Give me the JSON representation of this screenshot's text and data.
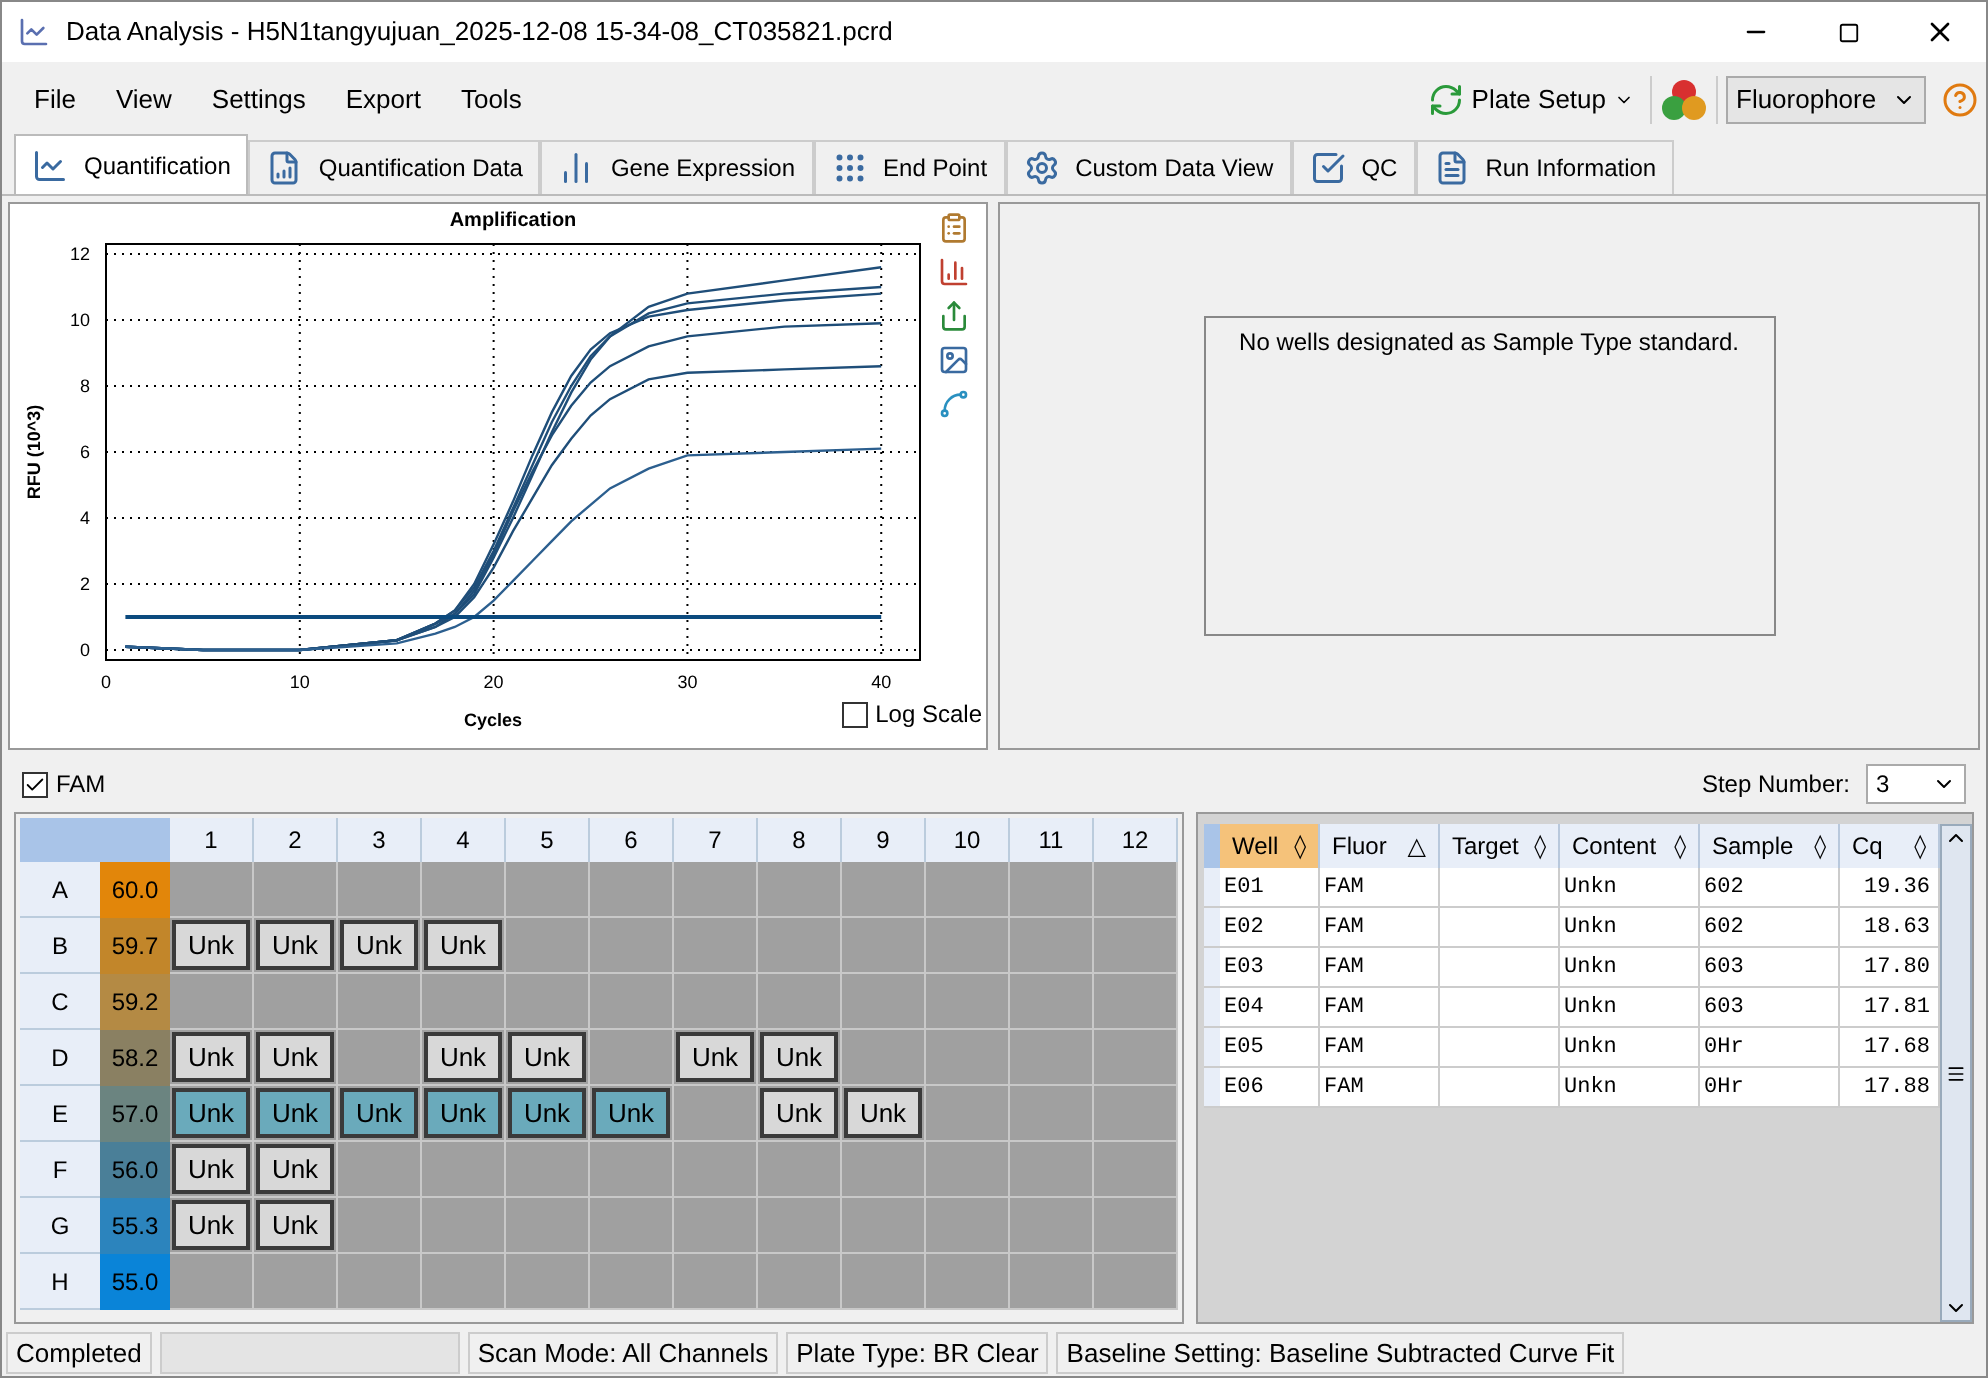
{
  "window": {
    "title": "Data Analysis - H5N1tangyujuan_2025-12-08 15-34-08_CT035821.pcrd"
  },
  "menu": [
    "File",
    "View",
    "Settings",
    "Export",
    "Tools"
  ],
  "toolbar": {
    "plate_setup": "Plate Setup",
    "fluorophore": "Fluorophore"
  },
  "tabs": [
    {
      "label": "Quantification",
      "selected": true
    },
    {
      "label": "Quantification Data",
      "selected": false
    },
    {
      "label": "Gene Expression",
      "selected": false
    },
    {
      "label": "End Point",
      "selected": false
    },
    {
      "label": "Custom Data View",
      "selected": false
    },
    {
      "label": "QC",
      "selected": false
    },
    {
      "label": "Run Information",
      "selected": false
    }
  ],
  "chart": {
    "log_scale": {
      "label": "Log Scale",
      "checked": false
    },
    "chart_data": {
      "type": "line",
      "title": "Amplification",
      "xlabel": "Cycles",
      "ylabel": "RFU (10^3)",
      "x": [
        1,
        5,
        10,
        15,
        17,
        18,
        19,
        20,
        21,
        22,
        23,
        24,
        25,
        26,
        28,
        30,
        35,
        40
      ],
      "series": [
        {
          "color": "#1f4e79",
          "values": [
            0.1,
            0,
            0,
            0.3,
            0.7,
            1.1,
            1.7,
            2.8,
            4.0,
            5.3,
            6.6,
            7.8,
            8.8,
            9.5,
            10.4,
            10.8,
            11.2,
            11.6
          ]
        },
        {
          "color": "#1f4e79",
          "values": [
            0.1,
            0,
            0,
            0.3,
            0.8,
            1.2,
            1.9,
            3.0,
            4.3,
            5.6,
            6.9,
            8.0,
            8.9,
            9.5,
            10.2,
            10.5,
            10.8,
            11.0
          ]
        },
        {
          "color": "#1f4e79",
          "values": [
            0.1,
            0,
            0,
            0.3,
            0.8,
            1.2,
            2.0,
            3.2,
            4.5,
            5.9,
            7.2,
            8.3,
            9.1,
            9.6,
            10.1,
            10.3,
            10.6,
            10.8
          ]
        },
        {
          "color": "#1f4e79",
          "values": [
            0.1,
            0,
            0,
            0.3,
            0.8,
            1.1,
            1.8,
            2.9,
            4.2,
            5.4,
            6.5,
            7.4,
            8.1,
            8.6,
            9.2,
            9.5,
            9.8,
            9.9
          ]
        },
        {
          "color": "#1f4e79",
          "values": [
            0.1,
            0,
            0,
            0.3,
            0.7,
            1.0,
            1.6,
            2.5,
            3.6,
            4.6,
            5.6,
            6.4,
            7.1,
            7.6,
            8.2,
            8.4,
            8.5,
            8.6
          ]
        },
        {
          "color": "#2c5f8f",
          "values": [
            0.1,
            0,
            0,
            0.2,
            0.5,
            0.7,
            1.0,
            1.5,
            2.1,
            2.7,
            3.3,
            3.9,
            4.4,
            4.9,
            5.5,
            5.9,
            6.0,
            6.1
          ]
        },
        {
          "color": "#0b4a7e",
          "values": [
            1,
            1,
            1,
            1,
            1,
            1,
            1,
            1,
            1,
            1,
            1,
            1,
            1,
            1,
            1,
            1,
            1,
            1
          ]
        }
      ],
      "grid": true,
      "xlim": [
        0,
        42
      ],
      "ylim": [
        -0.3,
        12.3
      ],
      "xticks": [
        0,
        10,
        20,
        30,
        40
      ],
      "yticks": [
        0,
        2,
        4,
        6,
        8,
        10,
        12
      ]
    }
  },
  "standard_curve": {
    "message": "No wells designated as Sample Type standard."
  },
  "fluor_filter": {
    "label": "FAM",
    "checked": true
  },
  "step": {
    "label": "Step Number:",
    "value": "3"
  },
  "plate": {
    "columns": [
      "1",
      "2",
      "3",
      "4",
      "5",
      "6",
      "7",
      "8",
      "9",
      "10",
      "11",
      "12"
    ],
    "rows": [
      {
        "label": "A",
        "temperature": "60.0",
        "color": "#e2860a",
        "wells": [
          {
            "kind": "empty"
          },
          {
            "kind": "empty"
          },
          {
            "kind": "empty"
          },
          {
            "kind": "empty"
          },
          {
            "kind": "empty"
          },
          {
            "kind": "empty"
          },
          {
            "kind": "empty"
          },
          {
            "kind": "empty"
          },
          {
            "kind": "empty"
          },
          {
            "kind": "empty"
          },
          {
            "kind": "empty"
          },
          {
            "kind": "empty"
          }
        ]
      },
      {
        "label": "B",
        "temperature": "59.7",
        "color": "#c2862a",
        "wells": [
          {
            "kind": "sample",
            "label": "Unk",
            "selected": false
          },
          {
            "kind": "sample",
            "label": "Unk",
            "selected": false
          },
          {
            "kind": "sample",
            "label": "Unk",
            "selected": false
          },
          {
            "kind": "sample",
            "label": "Unk",
            "selected": false
          },
          {
            "kind": "empty"
          },
          {
            "kind": "empty"
          },
          {
            "kind": "empty"
          },
          {
            "kind": "empty"
          },
          {
            "kind": "empty"
          },
          {
            "kind": "empty"
          },
          {
            "kind": "empty"
          },
          {
            "kind": "empty"
          }
        ]
      },
      {
        "label": "C",
        "temperature": "59.2",
        "color": "#b48a44",
        "wells": [
          {
            "kind": "empty"
          },
          {
            "kind": "empty"
          },
          {
            "kind": "empty"
          },
          {
            "kind": "empty"
          },
          {
            "kind": "empty"
          },
          {
            "kind": "empty"
          },
          {
            "kind": "empty"
          },
          {
            "kind": "empty"
          },
          {
            "kind": "empty"
          },
          {
            "kind": "empty"
          },
          {
            "kind": "empty"
          },
          {
            "kind": "empty"
          }
        ]
      },
      {
        "label": "D",
        "temperature": "58.2",
        "color": "#8a8062",
        "wells": [
          {
            "kind": "sample",
            "label": "Unk",
            "selected": false
          },
          {
            "kind": "sample",
            "label": "Unk",
            "selected": false
          },
          {
            "kind": "empty"
          },
          {
            "kind": "sample",
            "label": "Unk",
            "selected": false
          },
          {
            "kind": "sample",
            "label": "Unk",
            "selected": false
          },
          {
            "kind": "empty"
          },
          {
            "kind": "sample",
            "label": "Unk",
            "selected": false
          },
          {
            "kind": "sample",
            "label": "Unk",
            "selected": false
          },
          {
            "kind": "empty"
          },
          {
            "kind": "empty"
          },
          {
            "kind": "empty"
          },
          {
            "kind": "empty"
          }
        ]
      },
      {
        "label": "E",
        "temperature": "57.0",
        "color": "#6b8480",
        "wells": [
          {
            "kind": "sample",
            "label": "Unk",
            "selected": true
          },
          {
            "kind": "sample",
            "label": "Unk",
            "selected": true
          },
          {
            "kind": "sample",
            "label": "Unk",
            "selected": true
          },
          {
            "kind": "sample",
            "label": "Unk",
            "selected": true
          },
          {
            "kind": "sample",
            "label": "Unk",
            "selected": true
          },
          {
            "kind": "sample",
            "label": "Unk",
            "selected": true
          },
          {
            "kind": "empty"
          },
          {
            "kind": "sample",
            "label": "Unk",
            "selected": false
          },
          {
            "kind": "sample",
            "label": "Unk",
            "selected": false
          },
          {
            "kind": "empty"
          },
          {
            "kind": "empty"
          },
          {
            "kind": "empty"
          }
        ]
      },
      {
        "label": "F",
        "temperature": "56.0",
        "color": "#4a7f98",
        "wells": [
          {
            "kind": "sample",
            "label": "Unk",
            "selected": false
          },
          {
            "kind": "sample",
            "label": "Unk",
            "selected": false
          },
          {
            "kind": "empty"
          },
          {
            "kind": "empty"
          },
          {
            "kind": "empty"
          },
          {
            "kind": "empty"
          },
          {
            "kind": "empty"
          },
          {
            "kind": "empty"
          },
          {
            "kind": "empty"
          },
          {
            "kind": "empty"
          },
          {
            "kind": "empty"
          },
          {
            "kind": "empty"
          }
        ]
      },
      {
        "label": "G",
        "temperature": "55.3",
        "color": "#2c84bd",
        "wells": [
          {
            "kind": "sample",
            "label": "Unk",
            "selected": false
          },
          {
            "kind": "sample",
            "label": "Unk",
            "selected": false
          },
          {
            "kind": "empty"
          },
          {
            "kind": "empty"
          },
          {
            "kind": "empty"
          },
          {
            "kind": "empty"
          },
          {
            "kind": "empty"
          },
          {
            "kind": "empty"
          },
          {
            "kind": "empty"
          },
          {
            "kind": "empty"
          },
          {
            "kind": "empty"
          },
          {
            "kind": "empty"
          }
        ]
      },
      {
        "label": "H",
        "temperature": "55.0",
        "color": "#0a84d8",
        "wells": [
          {
            "kind": "empty"
          },
          {
            "kind": "empty"
          },
          {
            "kind": "empty"
          },
          {
            "kind": "empty"
          },
          {
            "kind": "empty"
          },
          {
            "kind": "empty"
          },
          {
            "kind": "empty"
          },
          {
            "kind": "empty"
          },
          {
            "kind": "empty"
          },
          {
            "kind": "empty"
          },
          {
            "kind": "empty"
          },
          {
            "kind": "empty"
          }
        ]
      }
    ]
  },
  "table": {
    "columns": [
      {
        "label": "Well",
        "sort_mark": "◊",
        "selected": true
      },
      {
        "label": "Fluor",
        "sort_mark": "△",
        "selected": false
      },
      {
        "label": "Target",
        "sort_mark": "◊",
        "selected": false
      },
      {
        "label": "Content",
        "sort_mark": "◊",
        "selected": false
      },
      {
        "label": "Sample",
        "sort_mark": "◊",
        "selected": false
      },
      {
        "label": "Cq",
        "sort_mark": "◊",
        "selected": false
      }
    ],
    "rows": [
      [
        "E01",
        "FAM",
        "",
        "Unkn",
        "602",
        "19.36"
      ],
      [
        "E02",
        "FAM",
        "",
        "Unkn",
        "602",
        "18.63"
      ],
      [
        "E03",
        "FAM",
        "",
        "Unkn",
        "603",
        "17.80"
      ],
      [
        "E04",
        "FAM",
        "",
        "Unkn",
        "603",
        "17.81"
      ],
      [
        "E05",
        "FAM",
        "",
        "Unkn",
        "0Hr",
        "17.68"
      ],
      [
        "E06",
        "FAM",
        "",
        "Unkn",
        "0Hr",
        "17.88"
      ]
    ]
  },
  "status_bar": {
    "status": "Completed",
    "scan_mode": "Scan Mode: All Channels",
    "plate_type": "Plate Type: BR Clear",
    "baseline": "Baseline Setting: Baseline Subtracted Curve Fit"
  }
}
